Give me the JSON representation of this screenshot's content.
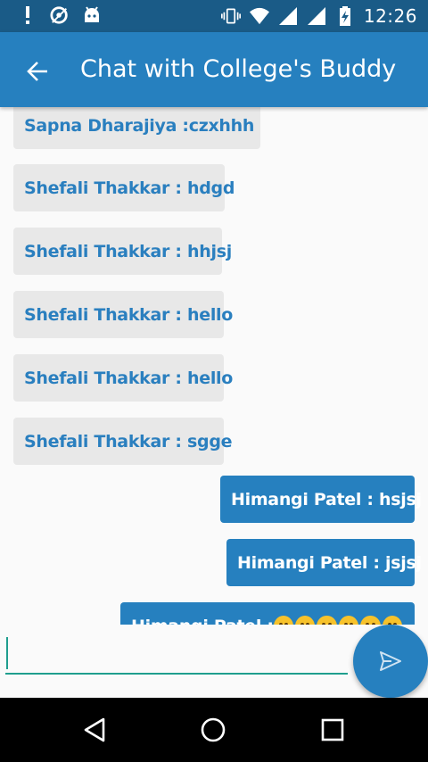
{
  "status_bar": {
    "time": "12:26",
    "icons": [
      "alert-icon",
      "location-off-icon",
      "android-icon",
      "vibrate-icon",
      "wifi-icon",
      "signal-icon",
      "signal-icon",
      "battery-charging-icon"
    ]
  },
  "app_bar": {
    "title": "Chat with College's Buddy",
    "back_icon": "arrow-back-icon"
  },
  "messages": [
    {
      "direction": "incoming",
      "sender": "Sapna Dharajiya :",
      "text": "czxhhh"
    },
    {
      "direction": "incoming",
      "sender": "Shefali Thakkar",
      "text": "Shefali Thakkar : hdgd"
    },
    {
      "direction": "incoming",
      "sender": "Shefali Thakkar",
      "text": "Shefali Thakkar : hhjsj"
    },
    {
      "direction": "incoming",
      "sender": "Shefali Thakkar",
      "text": "Shefali Thakkar : hello"
    },
    {
      "direction": "incoming",
      "sender": "Shefali Thakkar",
      "text": "Shefali Thakkar : hello"
    },
    {
      "direction": "incoming",
      "sender": "Shefali Thakkar",
      "text": "Shefali Thakkar : sgge"
    },
    {
      "direction": "outgoing",
      "sender": "Himangi Patel",
      "text": "Himangi Patel : hsjsj"
    },
    {
      "direction": "outgoing",
      "sender": "Himangi Patel",
      "text": "Himangi Patel : jsjsj"
    },
    {
      "direction": "outgoing",
      "sender": "Himangi Patel",
      "text": "Himangi Patel : "
    }
  ],
  "composer": {
    "value": "",
    "send_icon": "send-icon"
  },
  "nav_bar": {
    "icons": [
      "back-triangle-icon",
      "home-circle-icon",
      "recents-square-icon"
    ]
  },
  "colors": {
    "status_bar": "#1a5b87",
    "app_bar": "#2680bf",
    "incoming_bubble": "#e8e8e8",
    "incoming_text": "#2a7fbf",
    "outgoing_bubble": "#2680bf",
    "input_underline": "#1f9e8e"
  }
}
